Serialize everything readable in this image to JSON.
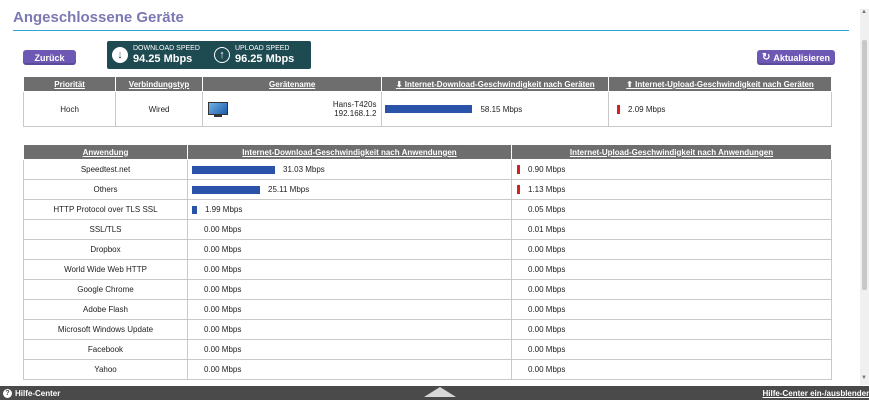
{
  "title": "Angeschlossene Geräte",
  "buttons": {
    "back": "Zurück",
    "refresh": "Aktualisieren"
  },
  "speed": {
    "download_label": "DOWNLOAD SPEED",
    "download_value": "94.25 Mbps",
    "upload_label": "UPLOAD SPEED",
    "upload_value": "96.25 Mbps"
  },
  "devices_table": {
    "headers": [
      "Priorität",
      "Verbindungstyp",
      "Gerätename",
      "Internet-Download-Geschwindigkeit nach Geräten",
      "Internet-Upload-Geschwindigkeit nach Geräten"
    ],
    "rows": [
      {
        "priority": "Hoch",
        "type": "Wired",
        "name": "Hans-T420s",
        "ip": "192.168.1.2",
        "download": "58.15 Mbps",
        "download_fraction": 0.62,
        "upload": "2.09 Mbps"
      }
    ]
  },
  "apps_table": {
    "headers": [
      "Anwendung",
      "Internet-Download-Geschwindigkeit nach Anwendungen",
      "Internet-Upload-Geschwindigkeit nach Anwendungen"
    ],
    "rows": [
      {
        "app": "Speedtest.net",
        "download": "31.03 Mbps",
        "dl_frac": 0.33,
        "upload": "0.90 Mbps",
        "ul_bar": true
      },
      {
        "app": "Others",
        "download": "25.11 Mbps",
        "dl_frac": 0.27,
        "upload": "1.13 Mbps",
        "ul_bar": true
      },
      {
        "app": "HTTP Protocol over TLS SSL",
        "download": "1.99 Mbps",
        "dl_frac": 0.02,
        "upload": "0.05 Mbps",
        "ul_bar": false
      },
      {
        "app": "SSL/TLS",
        "download": "0.00 Mbps",
        "dl_frac": 0,
        "upload": "0.01 Mbps",
        "ul_bar": false
      },
      {
        "app": "Dropbox",
        "download": "0.00 Mbps",
        "dl_frac": 0,
        "upload": "0.00 Mbps",
        "ul_bar": false
      },
      {
        "app": "World Wide Web HTTP",
        "download": "0.00 Mbps",
        "dl_frac": 0,
        "upload": "0.00 Mbps",
        "ul_bar": false
      },
      {
        "app": "Google Chrome",
        "download": "0.00 Mbps",
        "dl_frac": 0,
        "upload": "0.00 Mbps",
        "ul_bar": false
      },
      {
        "app": "Adobe Flash",
        "download": "0.00 Mbps",
        "dl_frac": 0,
        "upload": "0.00 Mbps",
        "ul_bar": false
      },
      {
        "app": "Microsoft Windows Update",
        "download": "0.00 Mbps",
        "dl_frac": 0,
        "upload": "0.00 Mbps",
        "ul_bar": false
      },
      {
        "app": "Facebook",
        "download": "0.00 Mbps",
        "dl_frac": 0,
        "upload": "0.00 Mbps",
        "ul_bar": false
      },
      {
        "app": "Yahoo",
        "download": "0.00 Mbps",
        "dl_frac": 0,
        "upload": "0.00 Mbps",
        "ul_bar": false
      }
    ]
  },
  "footer": {
    "help_center": "Hilfe-Center",
    "toggle": "Hilfe-Center ein-/ausblenden"
  },
  "colors": {
    "accent": "#6d59b3",
    "title": "#7b78b3",
    "bar_download": "#2a52a8",
    "bar_upload": "#d32020",
    "speed_box": "#1e4a52"
  },
  "icons": [
    "refresh-icon",
    "download-icon",
    "upload-icon",
    "computer-icon",
    "help-icon"
  ]
}
